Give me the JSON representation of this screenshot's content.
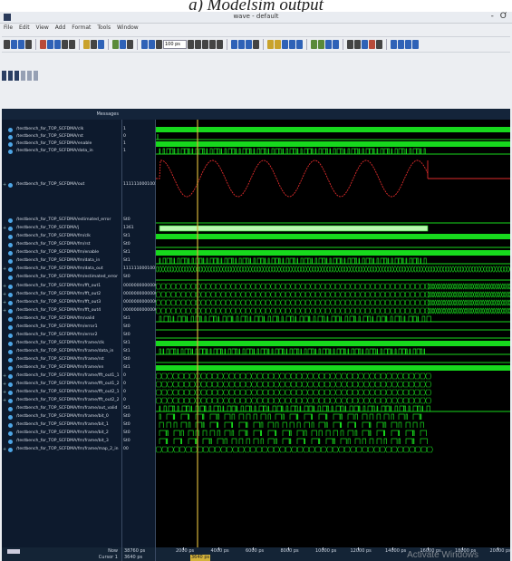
{
  "caption": "a) Modelsim output",
  "window": {
    "title": "wave - default",
    "controls": "- Ơ"
  },
  "menu": [
    "File",
    "Edit",
    "View",
    "Add",
    "Format",
    "Tools",
    "Window"
  ],
  "toolbar": {
    "time_field": "100 ps"
  },
  "wave_window": {
    "messages_header": "Messages",
    "signals": [
      {
        "name": "/testbench_for_TOP_SCFDMA/clk",
        "value": "1",
        "expandable": false
      },
      {
        "name": "/testbench_for_TOP_SCFDMA/rst",
        "value": "0",
        "expandable": false
      },
      {
        "name": "/testbench_for_TOP_SCFDMA/enable",
        "value": "1",
        "expandable": false
      },
      {
        "name": "/testbench_for_TOP_SCFDMA/data_in",
        "value": "1",
        "expandable": false
      },
      {
        "name": "/testbench_for_TOP_SCFDMA/out",
        "value": "1111110001001000",
        "expandable": true
      },
      {
        "name": "/testbench_for_TOP_SCFDMA/estimated_error",
        "value": "St0",
        "expandable": false
      },
      {
        "name": "/testbench_for_TOP_SCFDMA/j",
        "value": "1361",
        "expandable": true
      },
      {
        "name": "/testbench_for_TOP_SCFDMA/fm/clk",
        "value": "St1",
        "expandable": false
      },
      {
        "name": "/testbench_for_TOP_SCFDMA/fm/rst",
        "value": "St0",
        "expandable": false
      },
      {
        "name": "/testbench_for_TOP_SCFDMA/fm/enable",
        "value": "St1",
        "expandable": false
      },
      {
        "name": "/testbench_for_TOP_SCFDMA/fm/data_in",
        "value": "St1",
        "expandable": false
      },
      {
        "name": "/testbench_for_TOP_SCFDMA/fm/data_out",
        "value": "1111110001001000",
        "expandable": true
      },
      {
        "name": "/testbench_for_TOP_SCFDMA/fm/estimated_error",
        "value": "St0",
        "expandable": false
      },
      {
        "name": "/testbench_for_TOP_SCFDMA/fm/fft_out1",
        "value": "00000000000000000",
        "expandable": true
      },
      {
        "name": "/testbench_for_TOP_SCFDMA/fm/fft_out2",
        "value": "00000000000000000",
        "expandable": true
      },
      {
        "name": "/testbench_for_TOP_SCFDMA/fm/fft_out3",
        "value": "00000000000000000",
        "expandable": true
      },
      {
        "name": "/testbench_for_TOP_SCFDMA/fm/fft_out4",
        "value": "00000000000000000",
        "expandable": true
      },
      {
        "name": "/testbench_for_TOP_SCFDMA/fm/valid",
        "value": "St1",
        "expandable": false
      },
      {
        "name": "/testbench_for_TOP_SCFDMA/fm/error1",
        "value": "St0",
        "expandable": false
      },
      {
        "name": "/testbench_for_TOP_SCFDMA/fm/error2",
        "value": "St0",
        "expandable": false
      },
      {
        "name": "/testbench_for_TOP_SCFDMA/fm/frame/clk",
        "value": "St1",
        "expandable": false
      },
      {
        "name": "/testbench_for_TOP_SCFDMA/fm/frame/data_in",
        "value": "St1",
        "expandable": false
      },
      {
        "name": "/testbench_for_TOP_SCFDMA/fm/frame/rst",
        "value": "St0",
        "expandable": false
      },
      {
        "name": "/testbench_for_TOP_SCFDMA/fm/frame/en",
        "value": "St1",
        "expandable": false
      },
      {
        "name": "/testbench_for_TOP_SCFDMA/fm/frame/fft_out1_1",
        "value": "0",
        "expandable": true
      },
      {
        "name": "/testbench_for_TOP_SCFDMA/fm/frame/fft_out1_2",
        "value": "0",
        "expandable": true
      },
      {
        "name": "/testbench_for_TOP_SCFDMA/fm/frame/fft_out2_1",
        "value": "0",
        "expandable": true
      },
      {
        "name": "/testbench_for_TOP_SCFDMA/fm/frame/fft_out2_2",
        "value": "0",
        "expandable": true
      },
      {
        "name": "/testbench_for_TOP_SCFDMA/fm/frame/out_valid",
        "value": "St1",
        "expandable": false
      },
      {
        "name": "/testbench_for_TOP_SCFDMA/fm/frame/bit_0",
        "value": "St0",
        "expandable": false
      },
      {
        "name": "/testbench_for_TOP_SCFDMA/fm/frame/bit_1",
        "value": "St0",
        "expandable": false
      },
      {
        "name": "/testbench_for_TOP_SCFDMA/fm/frame/bit_2",
        "value": "St0",
        "expandable": false
      },
      {
        "name": "/testbench_for_TOP_SCFDMA/fm/frame/bit_3",
        "value": "St0",
        "expandable": false
      },
      {
        "name": "/testbench_for_TOP_SCFDMA/fm/frame/map_2_in",
        "value": "00",
        "expandable": true
      }
    ],
    "status": {
      "now_label": "Now",
      "now_value": "38760 ps",
      "cursor_label": "Cursor 1",
      "cursor_value": "3640 ps",
      "cursor_time": "3640 ps",
      "time_ticks": [
        "2000 ps",
        "4000 ps",
        "6000 ps",
        "8000 ps",
        "10000 ps",
        "12000 ps",
        "14000 ps",
        "16000 ps",
        "18000 ps",
        "20000 ps"
      ],
      "watermark": "Activate Windows"
    },
    "colors": {
      "wave": "#17d91d",
      "analog": "#e02c2c",
      "cursor": "#d4b33a",
      "background": "#000000"
    }
  }
}
